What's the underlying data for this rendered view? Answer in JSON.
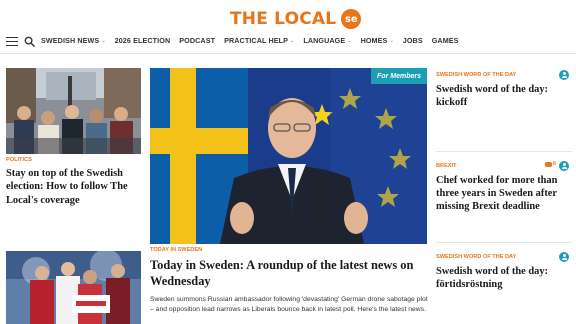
{
  "header": {
    "logo_text": "THE LOCAL",
    "logo_badge": "se",
    "brand_color": "#e8751a",
    "accent_color": "#1b9fb5"
  },
  "nav": {
    "items": [
      {
        "label": "SWEDISH NEWS",
        "has_caret": true
      },
      {
        "label": "2026 ELECTION",
        "has_caret": false
      },
      {
        "label": "PODCAST",
        "has_caret": false
      },
      {
        "label": "PRACTICAL HELP",
        "has_caret": true
      },
      {
        "label": "LANGUAGE",
        "has_caret": true
      },
      {
        "label": "HOMES",
        "has_caret": true
      },
      {
        "label": "JOBS",
        "has_caret": false
      },
      {
        "label": "GAMES",
        "has_caret": false
      }
    ],
    "caret": "⌄"
  },
  "left": {
    "kicker": "POLITICS",
    "headline": "Stay on top of the Swedish election: How to follow The Local's coverage"
  },
  "center": {
    "members_badge": "For Members",
    "kicker": "TODAY IN SWEDEN",
    "headline": "Today in Sweden: A roundup of the latest news on Wednesday",
    "summary": "Sweden summons Russian ambassador following 'devastating' German drone sabotage plot – and opposition lead narrows as Liberals bounce back in latest poll. Here's the latest news."
  },
  "right": {
    "items": [
      {
        "kicker": "SWEDISH WORD OF THE DAY",
        "headline": "Swedish word of the day: kickoff",
        "comments": ""
      },
      {
        "kicker": "BREXIT",
        "headline": "Chef worked for more than three years in Sweden after missing Brexit deadline",
        "comments": "6"
      },
      {
        "kicker": "SWEDISH WORD OF THE DAY",
        "headline": "Swedish word of the day: förtidsröstning",
        "comments": ""
      }
    ]
  }
}
